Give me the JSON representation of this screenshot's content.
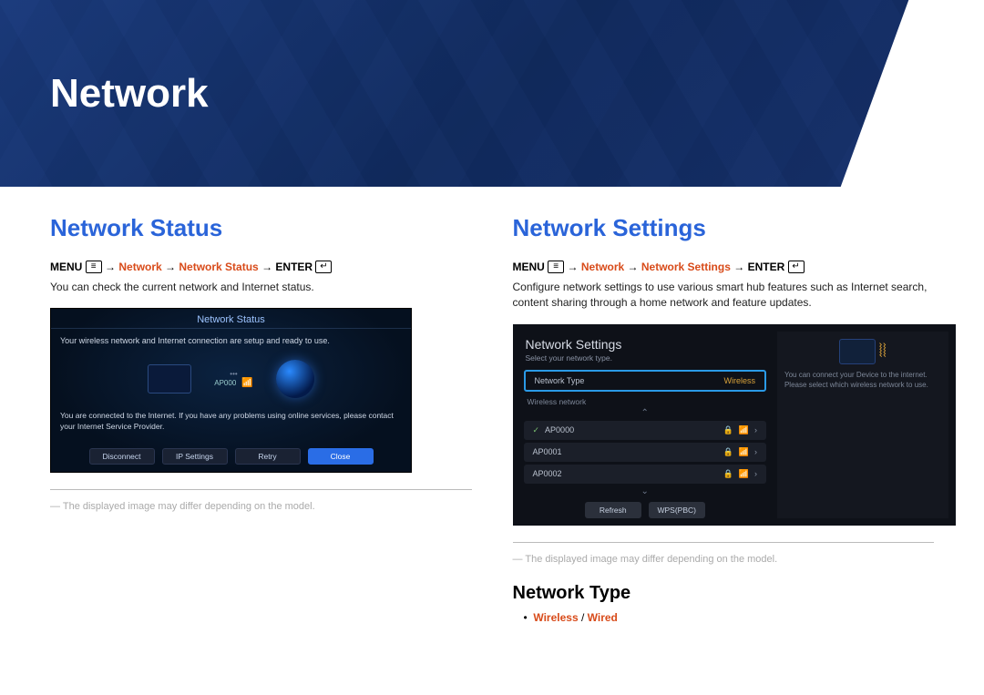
{
  "header": {
    "title": "Network"
  },
  "left": {
    "title": "Network Status",
    "nav": {
      "menu": "MENU",
      "seg1": "Network",
      "seg2": "Network Status",
      "enter": "ENTER"
    },
    "desc": "You can check the current network and Internet status.",
    "shot": {
      "title": "Network Status",
      "status_msg": "Your wireless network and Internet connection are setup and ready to use.",
      "ap_label": "AP000",
      "info_msg": "You are connected to the Internet. If you have any problems using online services, please contact your Internet Service Provider.",
      "buttons": [
        "Disconnect",
        "IP Settings",
        "Retry",
        "Close"
      ]
    },
    "footnote": "The displayed image may differ depending on the model."
  },
  "right": {
    "title": "Network Settings",
    "nav": {
      "menu": "MENU",
      "seg1": "Network",
      "seg2": "Network Settings",
      "enter": "ENTER"
    },
    "desc": "Configure network settings to use various smart hub features such as Internet search, content sharing through a home network and feature updates.",
    "shot": {
      "title": "Network Settings",
      "sub": "Select your network type.",
      "type_label": "Network Type",
      "type_value": "Wireless",
      "list_label": "Wireless network",
      "aps": [
        "AP0000",
        "AP0001",
        "AP0002"
      ],
      "buttons": [
        "Refresh",
        "WPS(PBC)"
      ],
      "side_text": "You can connect your Device to the internet. Please select which wireless network to use."
    },
    "footnote": "The displayed image may differ depending on the model.",
    "sub_heading": "Network Type",
    "type_options": {
      "a": "Wireless",
      "sep": " / ",
      "b": "Wired"
    }
  }
}
